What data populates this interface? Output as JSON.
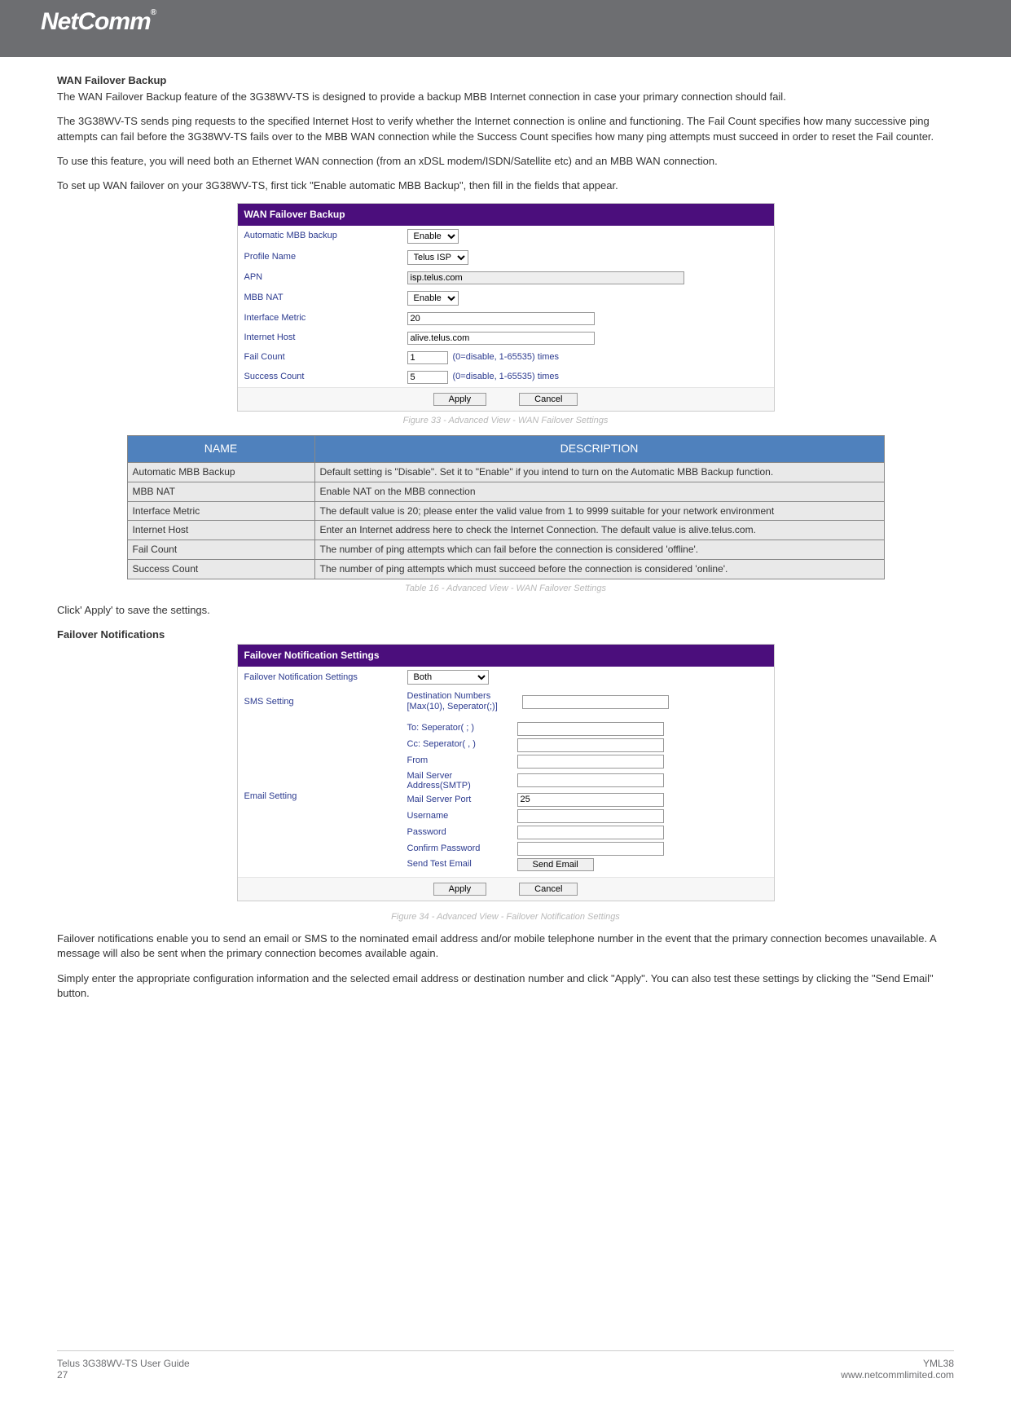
{
  "header": {
    "logo": "NetComm",
    "reg": "®"
  },
  "section1": {
    "title": "WAN Failover Backup",
    "p1": "The WAN Failover Backup feature of the 3G38WV-TS is designed to provide a backup MBB Internet connection in case your primary connection should fail.",
    "p2": "The 3G38WV-TS sends ping requests to the specified Internet Host to verify whether the Internet connection is online and functioning. The Fail Count specifies how many successive ping attempts can fail before the 3G38WV-TS fails over to the MBB WAN connection while the Success Count specifies how many ping attempts must succeed in order to reset the Fail counter.",
    "p3": "To use this feature, you will need both an Ethernet WAN connection (from an xDSL modem/ISDN/Satellite etc) and an MBB WAN connection.",
    "p4": "To set up WAN failover on your 3G38WV-TS, first tick \"Enable automatic MBB Backup\", then fill in the fields that appear."
  },
  "wanPanel": {
    "title": "WAN Failover Backup",
    "rows": {
      "autoBackup": {
        "label": "Automatic MBB backup",
        "value": "Enable"
      },
      "profile": {
        "label": "Profile Name",
        "value": "Telus ISP"
      },
      "apn": {
        "label": "APN",
        "value": "isp.telus.com"
      },
      "mbbnat": {
        "label": "MBB NAT",
        "value": "Enable"
      },
      "metric": {
        "label": "Interface Metric",
        "value": "20"
      },
      "host": {
        "label": "Internet Host",
        "value": "alive.telus.com"
      },
      "failCount": {
        "label": "Fail Count",
        "value": "1",
        "hint": "(0=disable, 1-65535) times"
      },
      "succCount": {
        "label": "Success Count",
        "value": "5",
        "hint": "(0=disable, 1-65535) times"
      }
    },
    "apply": "Apply",
    "cancel": "Cancel"
  },
  "caption1": "Figure 33 - Advanced View - WAN Failover Settings",
  "descTable": {
    "head": {
      "name": "NAME",
      "desc": "DESCRIPTION"
    },
    "rows": [
      {
        "n": "Automatic MBB Backup",
        "d": "Default setting is \"Disable\". Set it to \"Enable\" if you intend to turn on the Automatic MBB Backup function."
      },
      {
        "n": "MBB NAT",
        "d": "Enable NAT on the MBB connection"
      },
      {
        "n": "Interface Metric",
        "d": "The default value is 20; please enter the valid value from 1 to 9999 suitable for your network environment"
      },
      {
        "n": "Internet Host",
        "d": "Enter an Internet address here to check the Internet Connection. The default value is alive.telus.com."
      },
      {
        "n": "Fail Count",
        "d": "The number of ping attempts which can fail before the connection is considered 'offline'."
      },
      {
        "n": "Success Count",
        "d": "The number of ping attempts which must succeed before the connection is considered 'online'."
      }
    ]
  },
  "caption2": "Table 16 - Advanced View - WAN Failover Settings",
  "clickApply": "Click' Apply' to save the settings.",
  "section2Title": "Failover Notifications",
  "notifPanel": {
    "title": "Failover Notification Settings",
    "settingLabel": "Failover Notification Settings",
    "settingValue": "Both",
    "smsLabel": "SMS Setting",
    "smsDest": "Destination Numbers\n[Max(10), Seperator(;)]",
    "emailLabel": "Email Setting",
    "to": "To: Seperator( ; )",
    "cc": "Cc: Seperator( , )",
    "from": "From",
    "smtp": "Mail Server Address(SMTP)",
    "port": "Mail Server Port",
    "portValue": "25",
    "user": "Username",
    "pass": "Password",
    "cpass": "Confirm Password",
    "sendTest": "Send Test Email",
    "sendBtn": "Send Email",
    "apply": "Apply",
    "cancel": "Cancel"
  },
  "caption3": "Figure 34 - Advanced View - Failover Notification Settings",
  "para3a": "Failover notifications enable you to send an email or SMS to the nominated email address and/or mobile telephone number in the event that the primary connection becomes unavailable. A message will also be sent when the primary connection becomes available again.",
  "para3b": "Simply enter the appropriate configuration information and the selected email address or destination number and click \"Apply\". You can also test these settings by clicking the \"Send Email\" button.",
  "footer": {
    "leftTitle": "Telus 3G38WV-TS User Guide",
    "leftNum": "27",
    "rightTitle": "YML38",
    "rightUrl": "www.netcommlimited.com"
  }
}
